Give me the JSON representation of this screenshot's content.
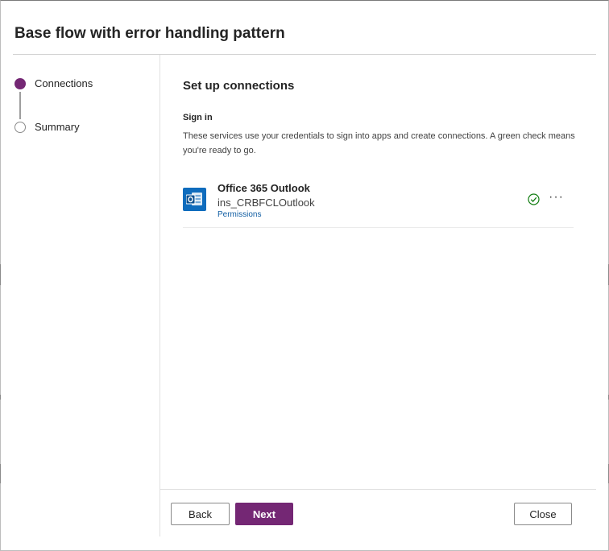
{
  "dialog": {
    "title": "Base flow with error handling pattern"
  },
  "steps": [
    {
      "label": "Connections",
      "state": "active"
    },
    {
      "label": "Summary",
      "state": "inactive"
    }
  ],
  "main": {
    "heading": "Set up connections",
    "signin_label": "Sign in",
    "description": "These services use your credentials to sign into apps and create connections. A green check means you're ready to go."
  },
  "connections": [
    {
      "name": "Office 365 Outlook",
      "account": "ins_CRBFCLOutlook",
      "permissions_link": "Permissions",
      "icon": "outlook-icon",
      "status_icon": "check-circle-icon",
      "more_label": "···"
    }
  ],
  "footer": {
    "back_label": "Back",
    "next_label": "Next",
    "close_label": "Close"
  },
  "colors": {
    "accent": "#742774",
    "outlook_blue": "#0f6cbd",
    "success_green": "#107c10",
    "link_blue": "#115ea3"
  }
}
